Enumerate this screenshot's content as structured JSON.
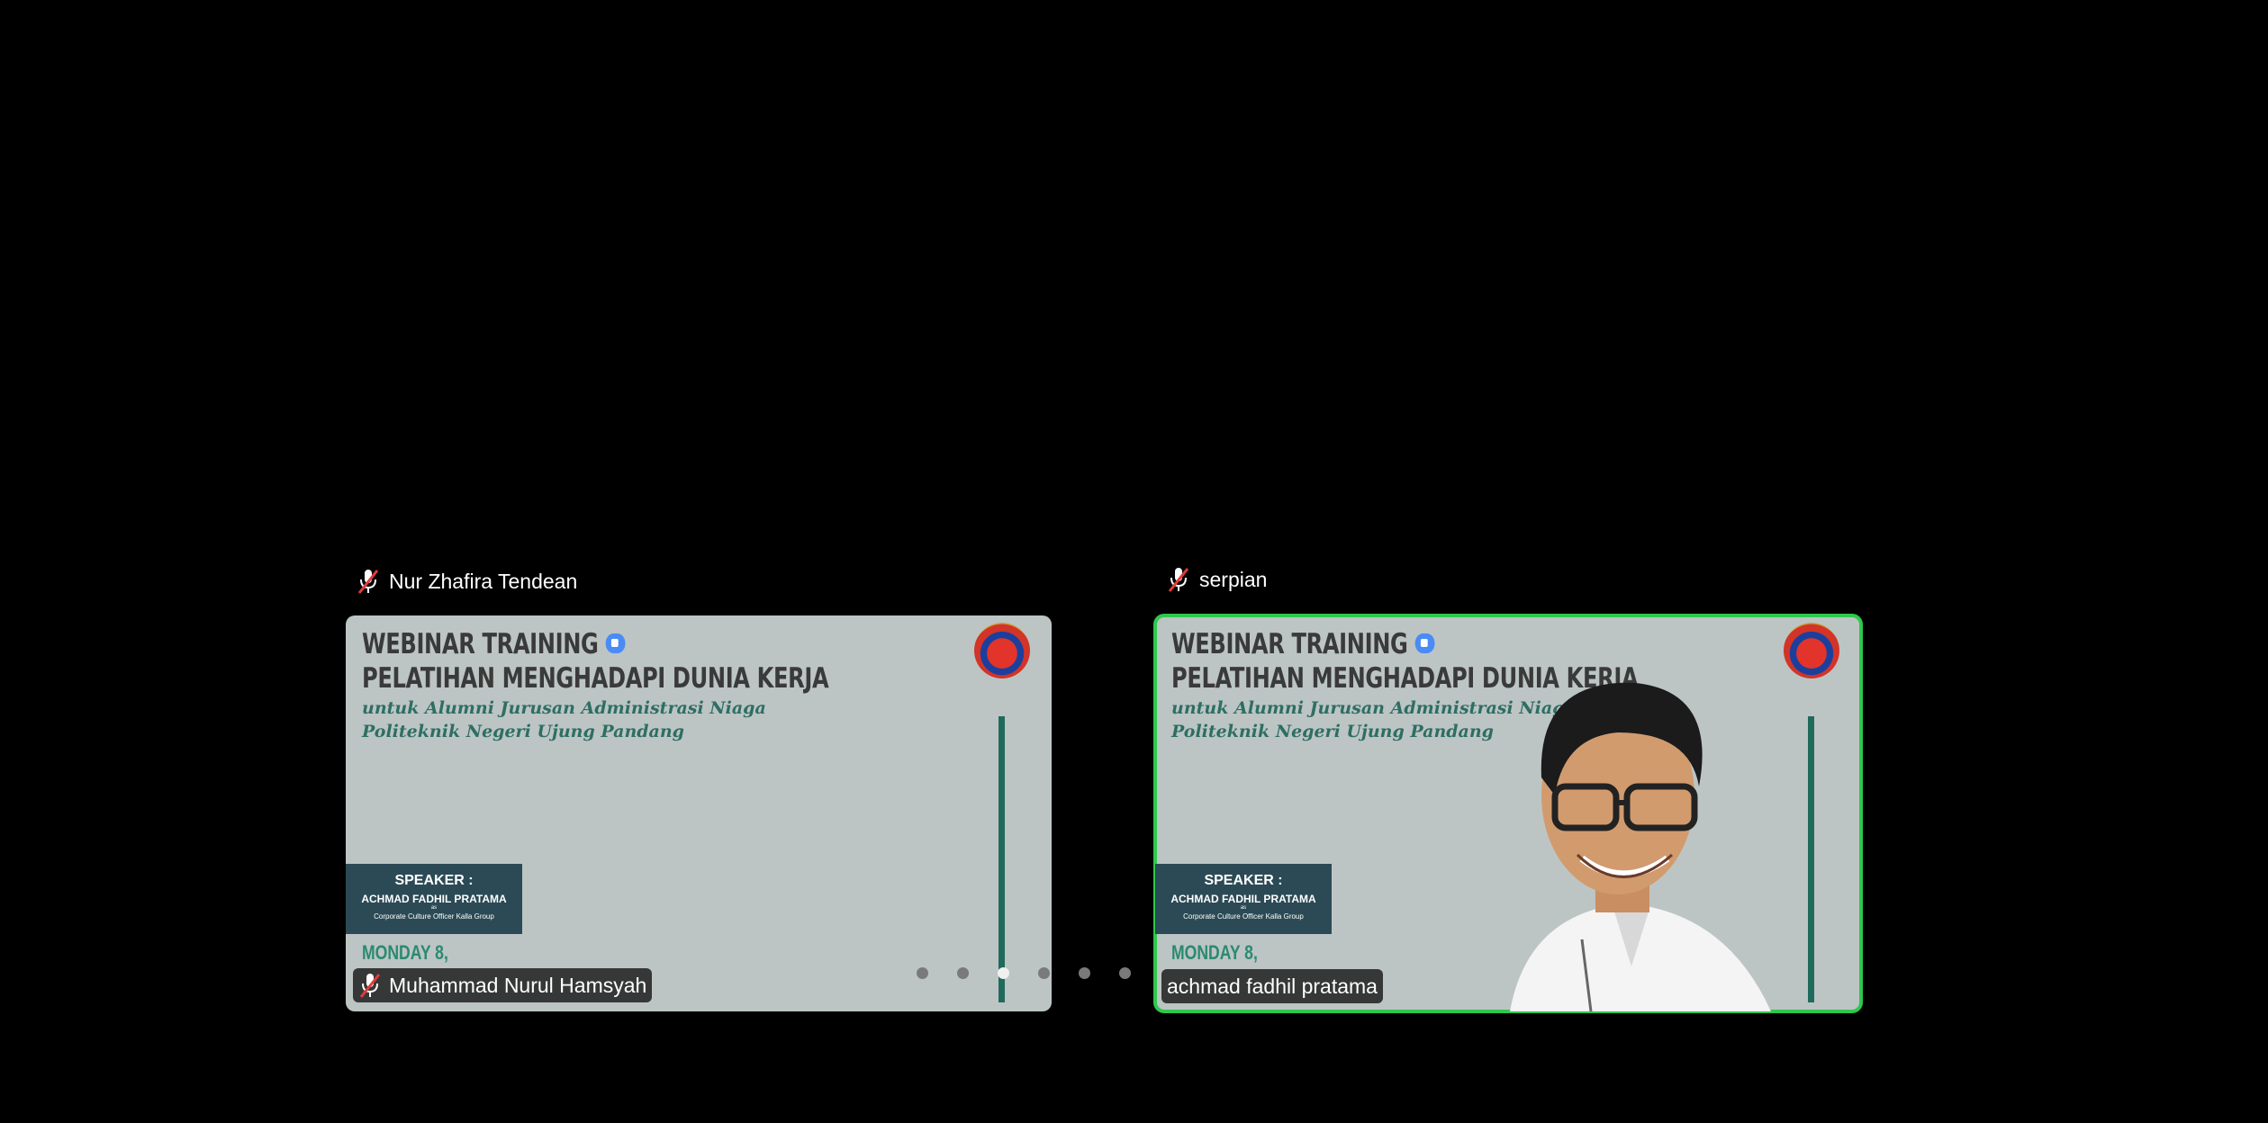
{
  "tiles": [
    {
      "top_name": "Nur Zhafira Tendean",
      "bottom_name": "Muhammad Nurul Hamsyah",
      "active": false,
      "slide": {
        "title_line1": "WEBINAR TRAINING",
        "title_line2": "PELATIHAN MENGHADAPI DUNIA KERJA",
        "subtitle_line1": "untuk Alumni Jurusan Administrasi Niaga",
        "subtitle_line2": "Politeknik Negeri Ujung Pandang",
        "speaker_heading": "SPEAKER :",
        "speaker_name": "ACHMAD FADHIL PRATAMA",
        "speaker_as": "as",
        "speaker_role": "Corporate Culture Officer Kalla Group",
        "date": "MONDAY 8,"
      }
    },
    {
      "top_name": "serpian",
      "bottom_name": "achmad fadhil pratama",
      "active": true,
      "slide": {
        "title_line1": "WEBINAR TRAINING",
        "title_line2": "PELATIHAN MENGHADAPI DUNIA KERJA",
        "subtitle_line1": "untuk Alumni Jurusan Administrasi Niaga",
        "subtitle_line2": "Politeknik Negeri Ujung Pandang",
        "speaker_heading": "SPEAKER :",
        "speaker_name": "ACHMAD FADHIL PRATAMA",
        "speaker_as": "as",
        "speaker_role": "Corporate Culture Officer Kalla Group",
        "date": "MONDAY 8,"
      }
    }
  ],
  "pagination": {
    "total_pages": 6,
    "current_page": 3
  },
  "icons": {
    "muted_mic": "mic-muted-icon",
    "video": "video-camera-icon",
    "logo": "institution-logo-icon"
  },
  "colors": {
    "active_border": "#2fc84c",
    "background": "#000000",
    "muted_mic": "#e23b3b"
  }
}
